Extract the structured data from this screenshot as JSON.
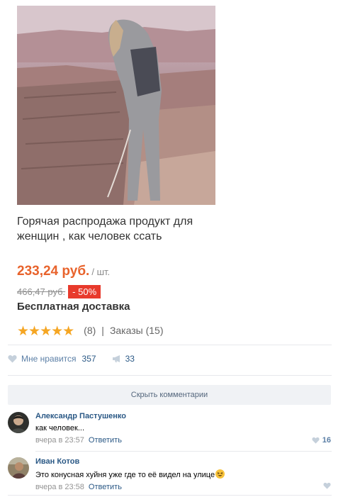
{
  "product": {
    "image_alt": "product-photo",
    "title": "Горячая распродажа продукт для женщин , как человек ссать",
    "price": "233,24 руб.",
    "unit": "/ шт.",
    "old_price": "466,47 руб.",
    "discount": "- 50%",
    "shipping": "Бесплатная доставка",
    "rating_stars": 5,
    "reviews": "(8)",
    "separator": "|",
    "orders": "Заказы (15)",
    "accent_color": "#e8632c",
    "discount_color": "#e83a2c",
    "star_color": "#f5a623"
  },
  "post": {
    "like_label": "Мне нравится",
    "like_count": "357",
    "share_count": "33"
  },
  "comments": {
    "hide_label": "Скрыть комментарии",
    "items": [
      {
        "author": "Александр Пастушенко",
        "text": "как человек...",
        "time": "вчера в 23:57",
        "reply": "Ответить",
        "likes": "16"
      },
      {
        "author": "Иван Котов",
        "text": "Это конусная хуйня уже где то её видел на улице",
        "time": "вчера в 23:58",
        "reply": "Ответить",
        "likes": ""
      }
    ]
  }
}
